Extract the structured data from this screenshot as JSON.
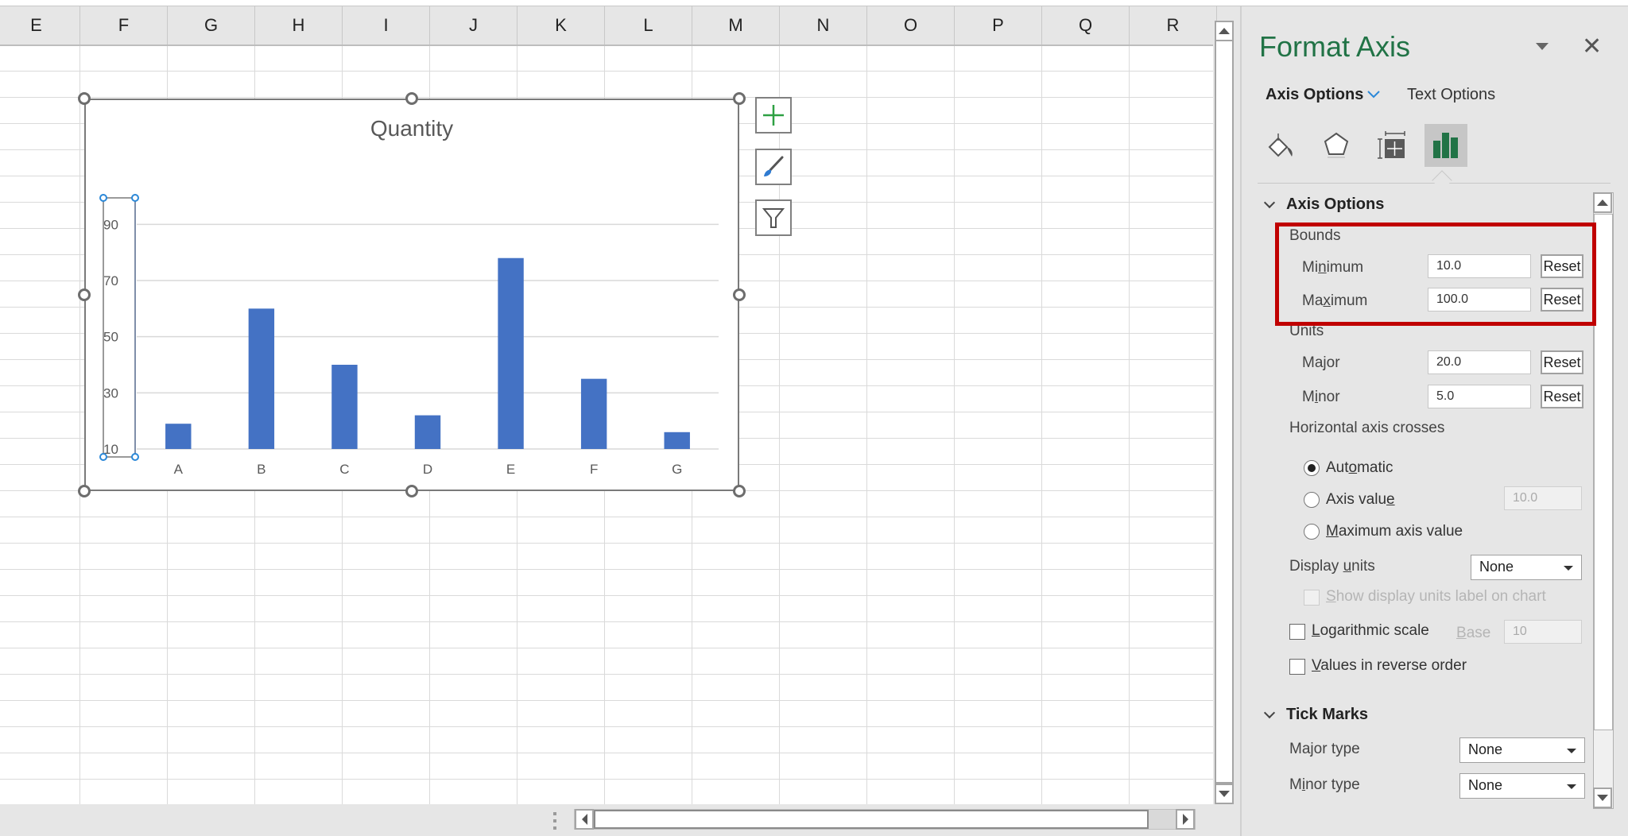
{
  "sheet": {
    "columns": [
      "E",
      "F",
      "G",
      "H",
      "I",
      "J",
      "K",
      "L",
      "M",
      "N",
      "O",
      "P",
      "Q",
      "R"
    ]
  },
  "chart": {
    "title": "Quantity",
    "side_buttons": {
      "add": "chart-elements-icon",
      "style": "chart-styles-icon",
      "filter": "chart-filters-icon"
    }
  },
  "chart_data": {
    "type": "bar",
    "title": "Quantity",
    "categories": [
      "A",
      "B",
      "C",
      "D",
      "E",
      "F",
      "G"
    ],
    "values": [
      19,
      60,
      40,
      22,
      78,
      35,
      16
    ],
    "xlabel": "",
    "ylabel": "",
    "ylim": [
      10,
      100
    ],
    "yticks": [
      10,
      30,
      50,
      70,
      90
    ],
    "ytick_labels": [
      "10",
      "30",
      "50",
      "70",
      "90"
    ],
    "grid": true,
    "legend": "none",
    "bar_color": "#4472c4"
  },
  "pane": {
    "title": "Format Axis",
    "tabs": [
      {
        "label": "Axis Options",
        "active": true
      },
      {
        "label": "Text Options",
        "active": false
      }
    ],
    "icon_tabs": [
      "fill-line-icon",
      "effects-icon",
      "size-properties-icon",
      "axis-options-icon"
    ],
    "sections": {
      "axis_options": {
        "title": "Axis Options",
        "bounds_label": "Bounds",
        "minimum_label": "Minimum",
        "minimum_value": "10.0",
        "maximum_label": "Maximum",
        "maximum_value": "100.0",
        "units_label": "Units",
        "major_label": "Major",
        "major_value": "20.0",
        "minor_label": "Minor",
        "minor_value": "5.0",
        "reset_label": "Reset",
        "crosses_label": "Horizontal axis crosses",
        "crosses_options": [
          {
            "label": "Automatic",
            "checked": true
          },
          {
            "label": "Axis value",
            "checked": false
          },
          {
            "label": "Maximum axis value",
            "checked": false
          }
        ],
        "axis_value": "10.0",
        "display_units_label": "Display units",
        "display_units_value": "None",
        "show_units_label": "Show display units label on chart",
        "log_scale_label": "Logarithmic scale",
        "base_label": "Base",
        "base_value": "10",
        "reverse_label": "Values in reverse order"
      },
      "tick_marks": {
        "title": "Tick Marks",
        "major_type_label": "Major type",
        "major_type_value": "None",
        "minor_type_label": "Minor type",
        "minor_type_value": "None"
      }
    }
  },
  "colors": {
    "accent_green": "#217346",
    "highlight_red": "#c00000",
    "bar_blue": "#4472c4"
  }
}
